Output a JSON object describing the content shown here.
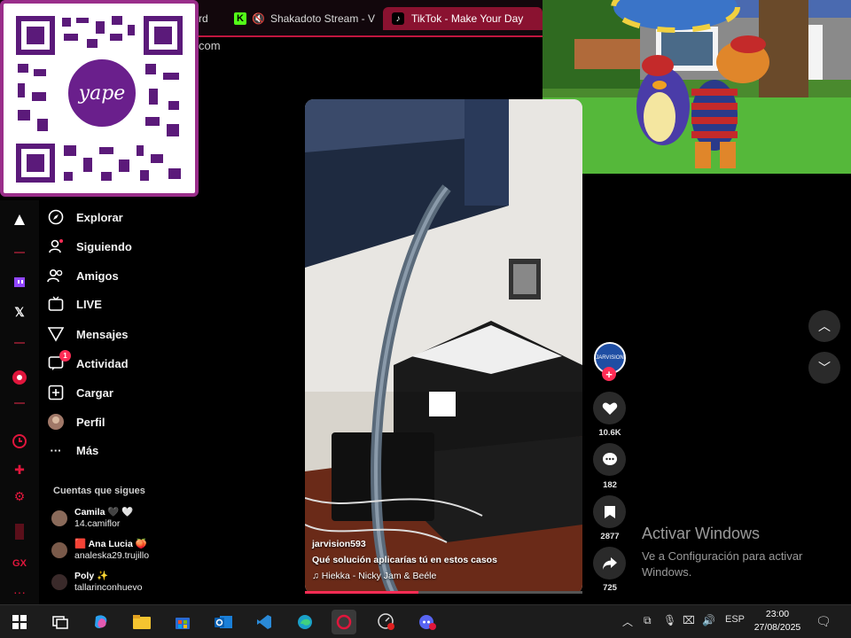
{
  "browser": {
    "tabs": [
      {
        "label": "rd",
        "active": false
      },
      {
        "label": "Shakadoto Stream - V",
        "active": false,
        "muted": true,
        "icon": "kick-icon"
      },
      {
        "label": "TikTok - Make Your Day",
        "active": true,
        "icon": "tiktok-icon"
      }
    ],
    "url_fragment": "com"
  },
  "overlay_qr": {
    "brand": "yape"
  },
  "sidebar_rail": {
    "icons": [
      "arc-icon",
      "twitch-icon",
      "x-icon",
      "music-icon",
      "clock-icon",
      "extensions-icon",
      "settings-icon",
      "gx-icon",
      "more-icon"
    ],
    "gx_label": "GX",
    "more_label": "···"
  },
  "nav": {
    "items": [
      {
        "label": "Explorar",
        "icon": "compass-icon"
      },
      {
        "label": "Siguiendo",
        "icon": "following-icon"
      },
      {
        "label": "Amigos",
        "icon": "friends-icon"
      },
      {
        "label": "LIVE",
        "icon": "live-icon"
      },
      {
        "label": "Mensajes",
        "icon": "messages-icon"
      },
      {
        "label": "Actividad",
        "icon": "activity-icon",
        "badge": "1"
      },
      {
        "label": "Cargar",
        "icon": "upload-icon"
      },
      {
        "label": "Perfil",
        "icon": "profile-icon"
      },
      {
        "label": "Más",
        "icon": "more-icon"
      }
    ],
    "following_title": "Cuentas que sigues",
    "following": [
      {
        "name": "Camila 🖤 🤍",
        "handle": "14.camiflor"
      },
      {
        "name": "🟥 Ana Lucia 🍑",
        "handle": "analeska29.trujillo"
      },
      {
        "name": "Poly ✨",
        "handle": "tallarinconhuevo"
      }
    ]
  },
  "video": {
    "author": "jarvision593",
    "description": "Qué solución aplicarías tú en estos casos",
    "music": "♫ Hiekka - Nicky Jam & Beéle",
    "progress": 0.41
  },
  "actions": {
    "likes": "10.6K",
    "comments": "182",
    "saves": "2877",
    "shares": "725"
  },
  "windows_notice": {
    "title": "Activar Windows",
    "line1": "Ve a Configuración para activar",
    "line2": "Windows."
  },
  "taskbar": {
    "tray_lang": "ESP",
    "time": "23:00",
    "date": "27/08/2025"
  }
}
